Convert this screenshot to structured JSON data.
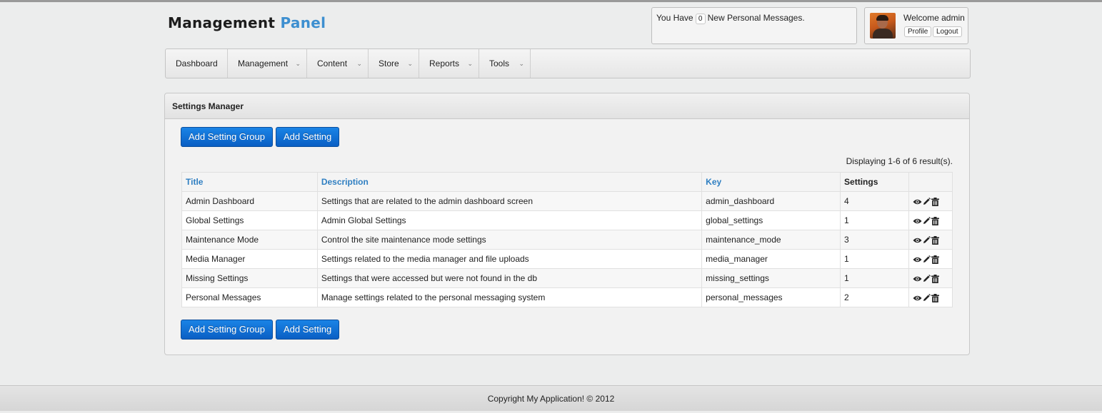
{
  "brand": {
    "part1": "Management",
    "part2": "Panel"
  },
  "messages": {
    "prefix": "You Have",
    "count": "0",
    "suffix": "New Personal Messages."
  },
  "user": {
    "welcome": "Welcome admin",
    "profile_label": "Profile",
    "logout_label": "Logout"
  },
  "nav": {
    "items": [
      {
        "label": "Dashboard",
        "has_dropdown": false
      },
      {
        "label": "Management",
        "has_dropdown": true
      },
      {
        "label": "Content",
        "has_dropdown": true
      },
      {
        "label": "Store",
        "has_dropdown": true
      },
      {
        "label": "Reports",
        "has_dropdown": true
      },
      {
        "label": "Tools",
        "has_dropdown": true
      }
    ]
  },
  "panel": {
    "title": "Settings Manager",
    "add_group_label": "Add Setting Group",
    "add_setting_label": "Add Setting",
    "result_count": "Displaying 1-6 of 6 result(s)."
  },
  "table": {
    "headers": {
      "title": "Title",
      "description": "Description",
      "key": "Key",
      "settings": "Settings"
    },
    "rows": [
      {
        "title": "Admin Dashboard",
        "description": "Settings that are related to the admin dashboard screen",
        "key": "admin_dashboard",
        "settings": "4"
      },
      {
        "title": "Global Settings",
        "description": "Admin Global Settings",
        "key": "global_settings",
        "settings": "1"
      },
      {
        "title": "Maintenance Mode",
        "description": "Control the site maintenance mode settings",
        "key": "maintenance_mode",
        "settings": "3"
      },
      {
        "title": "Media Manager",
        "description": "Settings related to the media manager and file uploads",
        "key": "media_manager",
        "settings": "1"
      },
      {
        "title": "Missing Settings",
        "description": "Settings that were accessed but were not found in the db",
        "key": "missing_settings",
        "settings": "1"
      },
      {
        "title": "Personal Messages",
        "description": "Manage settings related to the personal messaging system",
        "key": "personal_messages",
        "settings": "2"
      }
    ]
  },
  "footer": {
    "copyright": "Copyright My Application! © 2012"
  },
  "colors": {
    "accent": "#3d8fd0",
    "button": "#0a6fd8",
    "link": "#2f7fc2"
  },
  "icons": {
    "row_actions": [
      "eye-icon",
      "pencil-icon",
      "trash-icon"
    ],
    "nav_dropdown": "chevron-down-icon"
  }
}
